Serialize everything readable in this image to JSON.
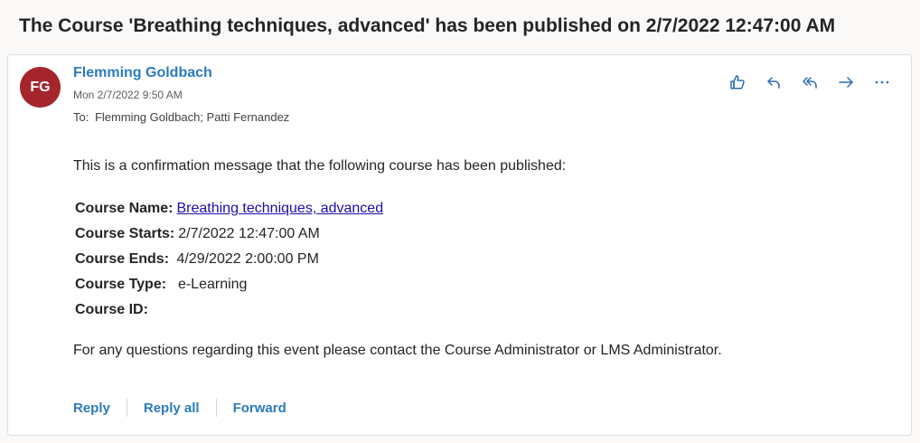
{
  "subject": "The Course 'Breathing techniques, advanced' has been published on 2/7/2022 12:47:00 AM",
  "message": {
    "avatar_initials": "FG",
    "avatar_color": "#a4262c",
    "sender": "Flemming Goldbach",
    "date": "Mon 2/7/2022 9:50 AM",
    "to_label": "To:",
    "recipients": "Flemming Goldbach; Patti Fernandez",
    "actions": [
      "like-icon",
      "reply-icon",
      "reply-all-icon",
      "forward-icon",
      "more-icon"
    ]
  },
  "body": {
    "intro": "This is a confirmation message that the following course has been published:",
    "details": [
      {
        "label": "Course Name:",
        "value": "Breathing techniques, advanced",
        "link": true
      },
      {
        "label": "Course Starts:",
        "value": "2/7/2022 12:47:00 AM"
      },
      {
        "label": "Course Ends:",
        "value": " 4/29/2022 2:00:00 PM"
      },
      {
        "label": "Course Type:",
        "value": "  e-Learning"
      },
      {
        "label": "Course ID:",
        "value": ""
      }
    ],
    "closing": "For any questions regarding this event please contact the Course Administrator or LMS Administrator."
  },
  "footer": {
    "reply": "Reply",
    "reply_all": "Reply all",
    "forward": "Forward"
  },
  "colors": {
    "accent": "#2b7bc0",
    "link": "#1a0dab"
  }
}
